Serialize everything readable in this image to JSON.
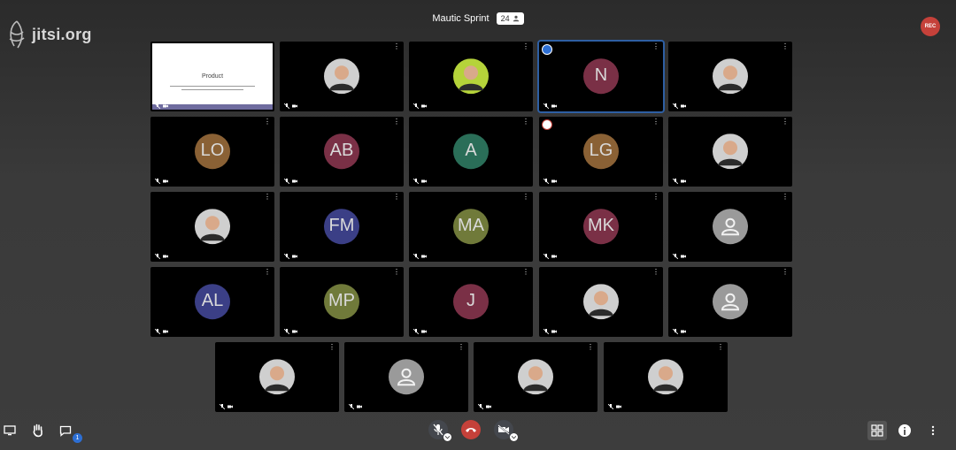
{
  "brand": {
    "logo_text": "jitsi.org"
  },
  "header": {
    "meeting_title": "Mautic Sprint",
    "participant_count": "24",
    "recording_label": "REC"
  },
  "colors": {
    "hangup": "#c5413a",
    "active_border": "#2e5fa3",
    "chat_badge": "#2d6fd4"
  },
  "tiles": [
    {
      "type": "slide",
      "slide_title": "Product"
    },
    {
      "type": "photo",
      "icon": "user-photo"
    },
    {
      "type": "photo",
      "icon": "user-photo-frankenstein"
    },
    {
      "type": "initials",
      "initials": "N",
      "color": "#7a3046",
      "active": true
    },
    {
      "type": "photo",
      "icon": "user-photo"
    },
    {
      "type": "initials",
      "initials": "LO",
      "color": "#8a6135"
    },
    {
      "type": "initials",
      "initials": "AB",
      "color": "#7a3046"
    },
    {
      "type": "initials",
      "initials": "A",
      "color": "#2a6e58"
    },
    {
      "type": "initials",
      "initials": "LG",
      "color": "#8a6135",
      "badge": true
    },
    {
      "type": "photo",
      "icon": "user-photo"
    },
    {
      "type": "photo",
      "icon": "user-photo"
    },
    {
      "type": "initials",
      "initials": "FM",
      "color": "#3b3f86"
    },
    {
      "type": "initials",
      "initials": "MA",
      "color": "#707a3a"
    },
    {
      "type": "initials",
      "initials": "MK",
      "color": "#7a3046"
    },
    {
      "type": "generic"
    },
    {
      "type": "initials",
      "initials": "AL",
      "color": "#3b3f86"
    },
    {
      "type": "initials",
      "initials": "MP",
      "color": "#707a3a"
    },
    {
      "type": "initials",
      "initials": "J",
      "color": "#7a3046"
    },
    {
      "type": "photo",
      "icon": "user-photo"
    },
    {
      "type": "generic"
    },
    {
      "type": "photo",
      "icon": "user-photo"
    },
    {
      "type": "generic"
    },
    {
      "type": "photo",
      "icon": "user-photo"
    },
    {
      "type": "photo",
      "icon": "user-photo"
    }
  ],
  "toolbar": {
    "chat_unread": "1"
  }
}
